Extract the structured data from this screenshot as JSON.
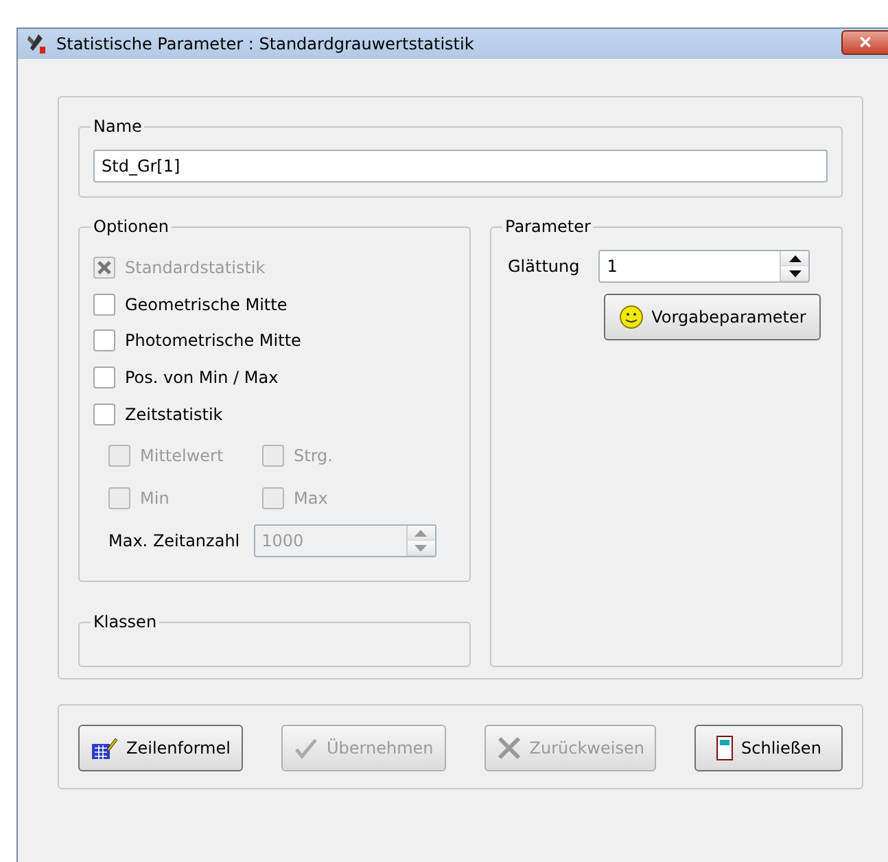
{
  "window": {
    "title": "Statistische Parameter : Standardgrauwertstatistik",
    "close": "✕"
  },
  "name_group": {
    "title": "Name",
    "value": "Std_Gr[1]"
  },
  "options_group": {
    "title": "Optionen",
    "options": [
      {
        "label": "Standardstatistik",
        "checked": true,
        "disabled": true
      },
      {
        "label": "Geometrische Mitte",
        "checked": false,
        "disabled": false
      },
      {
        "label": "Photometrische Mitte",
        "checked": false,
        "disabled": false
      },
      {
        "label": "Pos. von Min / Max",
        "checked": false,
        "disabled": false
      },
      {
        "label": "Zeitstatistik",
        "checked": false,
        "disabled": false
      }
    ],
    "time_options": [
      {
        "label": "Mittelwert",
        "checked": false,
        "disabled": true
      },
      {
        "label": "Strg.",
        "checked": false,
        "disabled": true
      },
      {
        "label": "Min",
        "checked": false,
        "disabled": true
      },
      {
        "label": "Max",
        "checked": false,
        "disabled": true
      }
    ],
    "max_count": {
      "label": "Max. Zeitanzahl",
      "value": "1000",
      "disabled": true
    }
  },
  "classes_group": {
    "title": "Klassen"
  },
  "parameter_group": {
    "title": "Parameter",
    "smoothing": {
      "label": "Glättung",
      "value": "1",
      "disabled": false
    },
    "defaults_button": "Vorgabeparameter"
  },
  "buttons": [
    {
      "kind": "formula",
      "label": "Zeilenformel",
      "disabled": false
    },
    {
      "kind": "apply",
      "label": "Übernehmen",
      "disabled": true
    },
    {
      "kind": "reject",
      "label": "Zurückweisen",
      "disabled": true
    },
    {
      "kind": "close",
      "label": "Schließen",
      "disabled": false
    }
  ]
}
